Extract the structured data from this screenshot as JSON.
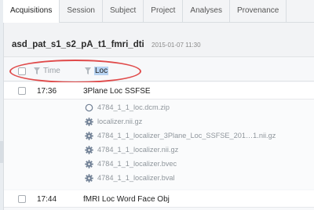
{
  "tabs": [
    {
      "label": "Acquisitions",
      "active": true
    },
    {
      "label": "Session",
      "active": false
    },
    {
      "label": "Subject",
      "active": false
    },
    {
      "label": "Project",
      "active": false
    },
    {
      "label": "Analyses",
      "active": false
    },
    {
      "label": "Provenance",
      "active": false
    }
  ],
  "session": {
    "title": "asd_pat_s1_s2_pA_t1_fmri_dti",
    "date": "2015-01-07 11:30"
  },
  "columns": {
    "time_label": "Time",
    "loc_label": "Loc"
  },
  "acquisitions": [
    {
      "time": "17:36",
      "name": "3Plane Loc SSFSE",
      "files": [
        {
          "icon": "circle-icon",
          "name": "4784_1_1_loc.dcm.zip"
        },
        {
          "icon": "gear-icon",
          "name": "localizer.nii.gz"
        },
        {
          "icon": "gear-icon",
          "name": "4784_1_1_localizer_3Plane_Loc_SSFSE_201…1.nii.gz"
        },
        {
          "icon": "gear-icon",
          "name": "4784_1_1_localizer.nii.gz"
        },
        {
          "icon": "gear-icon",
          "name": "4784_1_1_localizer.bvec"
        },
        {
          "icon": "gear-icon",
          "name": "4784_1_1_localizer.bval"
        }
      ]
    },
    {
      "time": "17:44",
      "name": "fMRI Loc Word Face Obj",
      "files": []
    }
  ],
  "colors": {
    "highlight_ellipse": "#e04a4a",
    "selection": "#b7d3f2",
    "icon": "#6f7f94"
  }
}
